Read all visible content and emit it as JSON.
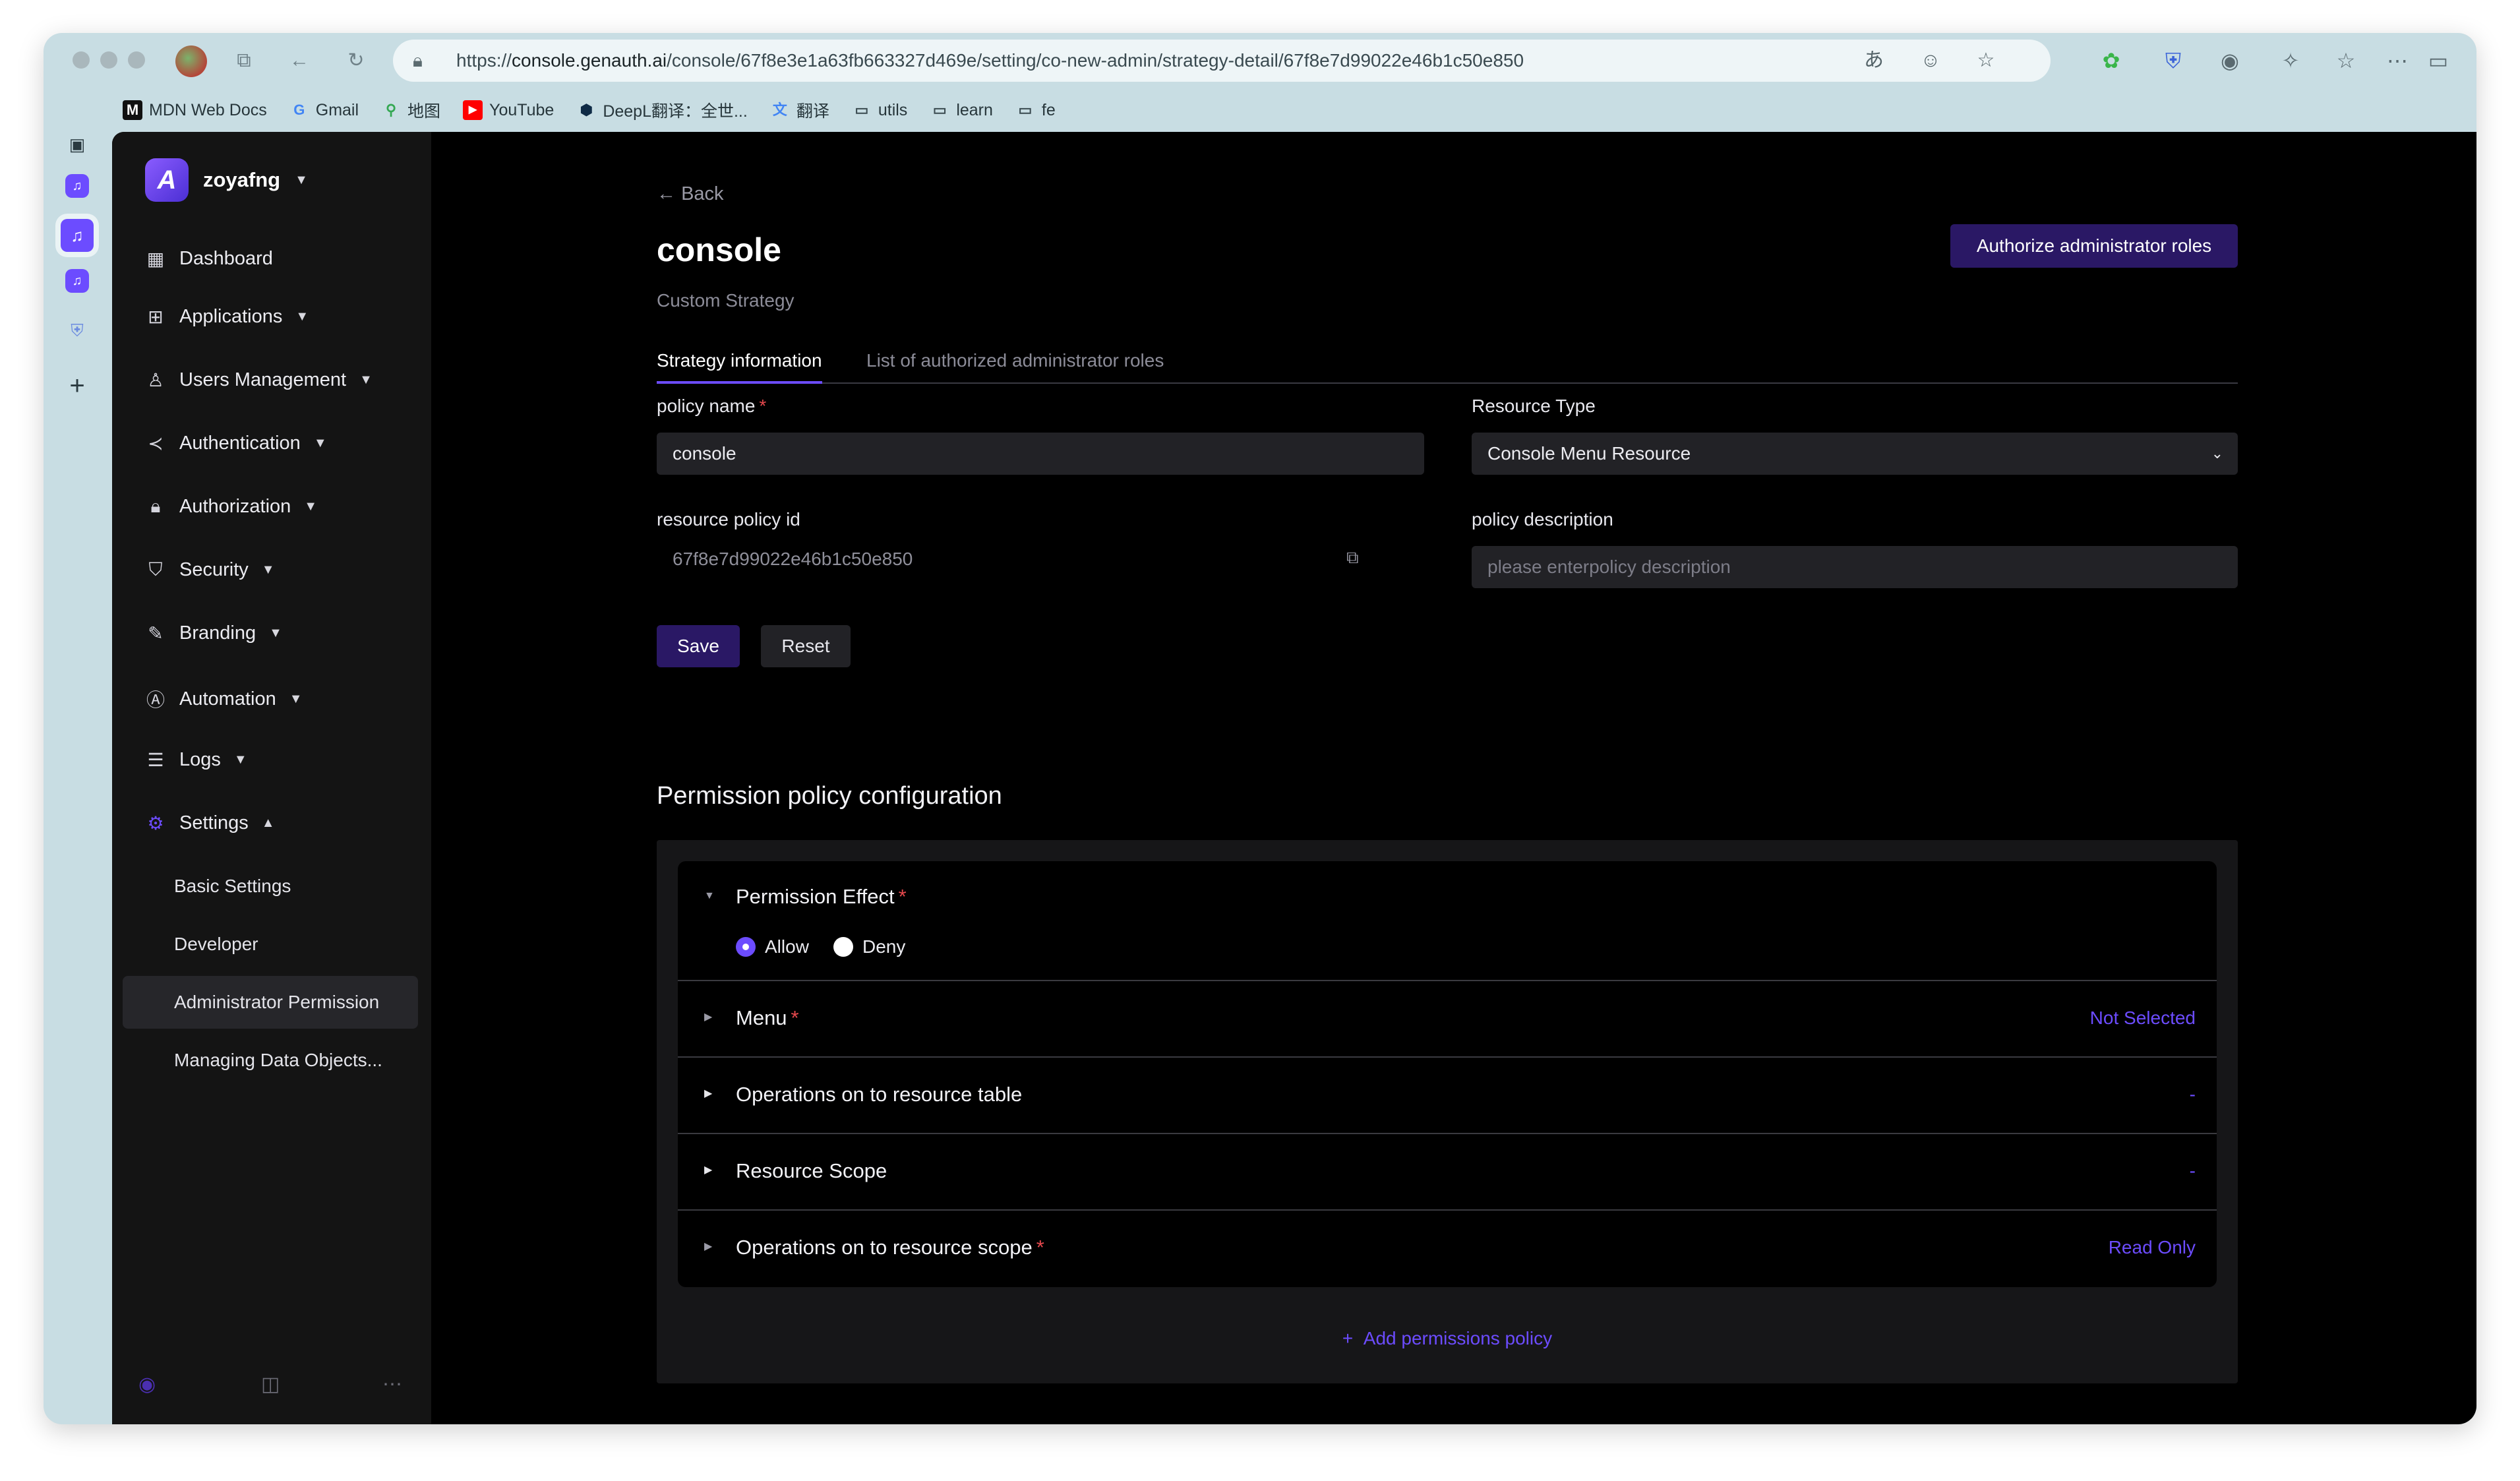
{
  "browser": {
    "url_prefix": "https://",
    "url_host": "console.genauth.ai",
    "url_path": "/console/67f8e3e1a63fb663327d469e/setting/co-new-admin/strategy-detail/67f8e7d99022e46b1c50e850",
    "bookmarks": [
      {
        "label": "MDN Web Docs",
        "icon": "mdn-icon"
      },
      {
        "label": "Gmail",
        "icon": "google-icon"
      },
      {
        "label": "地图",
        "icon": "maps-icon"
      },
      {
        "label": "YouTube",
        "icon": "youtube-icon"
      },
      {
        "label": "DeepL翻译：全世...",
        "icon": "deepl-icon"
      },
      {
        "label": "翻译",
        "icon": "translate-icon"
      },
      {
        "label": "utils",
        "icon": "folder-icon"
      },
      {
        "label": "learn",
        "icon": "folder-icon"
      },
      {
        "label": "fe",
        "icon": "folder-icon"
      }
    ]
  },
  "sidebar": {
    "org_name": "zoyafng",
    "nav": [
      {
        "label": "Dashboard",
        "icon": "dashboard-icon"
      },
      {
        "label": "Applications",
        "icon": "applications-icon"
      },
      {
        "label": "Users Management",
        "icon": "user-icon"
      },
      {
        "label": "Authentication",
        "icon": "share-icon"
      },
      {
        "label": "Authorization",
        "icon": "lock-icon"
      },
      {
        "label": "Security",
        "icon": "shield-icon"
      },
      {
        "label": "Branding",
        "icon": "brush-icon"
      },
      {
        "label": "Automation",
        "icon": "automation-icon"
      },
      {
        "label": "Logs",
        "icon": "logs-icon"
      },
      {
        "label": "Settings",
        "icon": "gear-icon"
      }
    ],
    "settings_sub": [
      {
        "label": "Basic Settings"
      },
      {
        "label": "Developer"
      },
      {
        "label": "Administrator Permission",
        "active": true
      },
      {
        "label": "Managing Data Objects..."
      }
    ]
  },
  "main": {
    "back_label": "Back",
    "title": "console",
    "subtitle": "Custom Strategy",
    "authorize_button": "Authorize administrator roles",
    "tabs": [
      {
        "label": "Strategy information",
        "active": true
      },
      {
        "label": "List of authorized administrator roles",
        "active": false
      }
    ],
    "form": {
      "policy_name_label": "policy name",
      "policy_name_value": "console",
      "resource_type_label": "Resource Type",
      "resource_type_value": "Console Menu Resource",
      "resource_policy_id_label": "resource policy id",
      "resource_policy_id_value": "67f8e7d99022e46b1c50e850",
      "policy_description_label": "policy description",
      "policy_description_placeholder": "please enterpolicy description",
      "save": "Save",
      "reset": "Reset"
    },
    "permission": {
      "title": "Permission policy configuration",
      "effect_title": "Permission Effect",
      "allow": "Allow",
      "deny": "Deny",
      "selected": "Allow",
      "menu_title": "Menu",
      "menu_value": "Not Selected",
      "ops_table_title": "Operations on to resource table",
      "ops_table_value": "-",
      "scope_title": "Resource Scope",
      "scope_value": "-",
      "ops_scope_title": "Operations on to resource scope",
      "ops_scope_value": "Read Only",
      "add_policy": "Add permissions policy"
    }
  },
  "colors": {
    "accent": "#6c4cff",
    "primary_button": "#2a1865",
    "required": "#e5484d",
    "sidebar_bg": "#141414",
    "main_bg": "#000000"
  }
}
